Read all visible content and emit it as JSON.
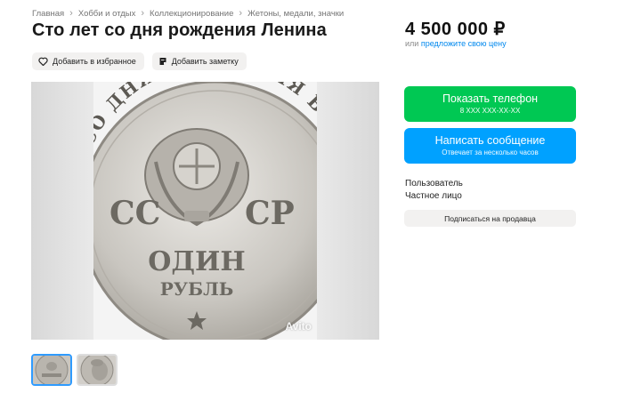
{
  "breadcrumbs": [
    "Главная",
    "Хобби и отдых",
    "Коллекционирование",
    "Жетоны, медали, значки"
  ],
  "title": "Сто лет со дня рождения Ленина",
  "actions": {
    "favorite_label": "Добавить в избранное",
    "note_label": "Добавить заметку"
  },
  "gallery": {
    "coin_text": {
      "arc_text": "СТО ЛЕТ СО ДНЯ РОЖДЕНИЯ В.И.ЛЕНИНА",
      "left_letters": "СС",
      "right_letters": "СР",
      "denomination_top": "ОДИН",
      "denomination_bottom": "РУБЛЬ"
    },
    "watermark": "Avito",
    "thumbnails_count": 2
  },
  "price": {
    "amount": "4 500 000 ₽",
    "or_label": "или",
    "offer_link": "предложите свою цену"
  },
  "contact": {
    "phone_label": "Показать телефон",
    "phone_sub": "8 XXX XXX-XX-XX",
    "message_label": "Написать сообщение",
    "message_sub": "Отвечает за несколько часов"
  },
  "seller": {
    "name": "Пользователь",
    "type": "Частное лицо",
    "subscribe_label": "Подписаться на продавца"
  },
  "colors": {
    "phone_button": "#00c853",
    "message_button": "#00a1ff",
    "link": "#0088ee"
  }
}
